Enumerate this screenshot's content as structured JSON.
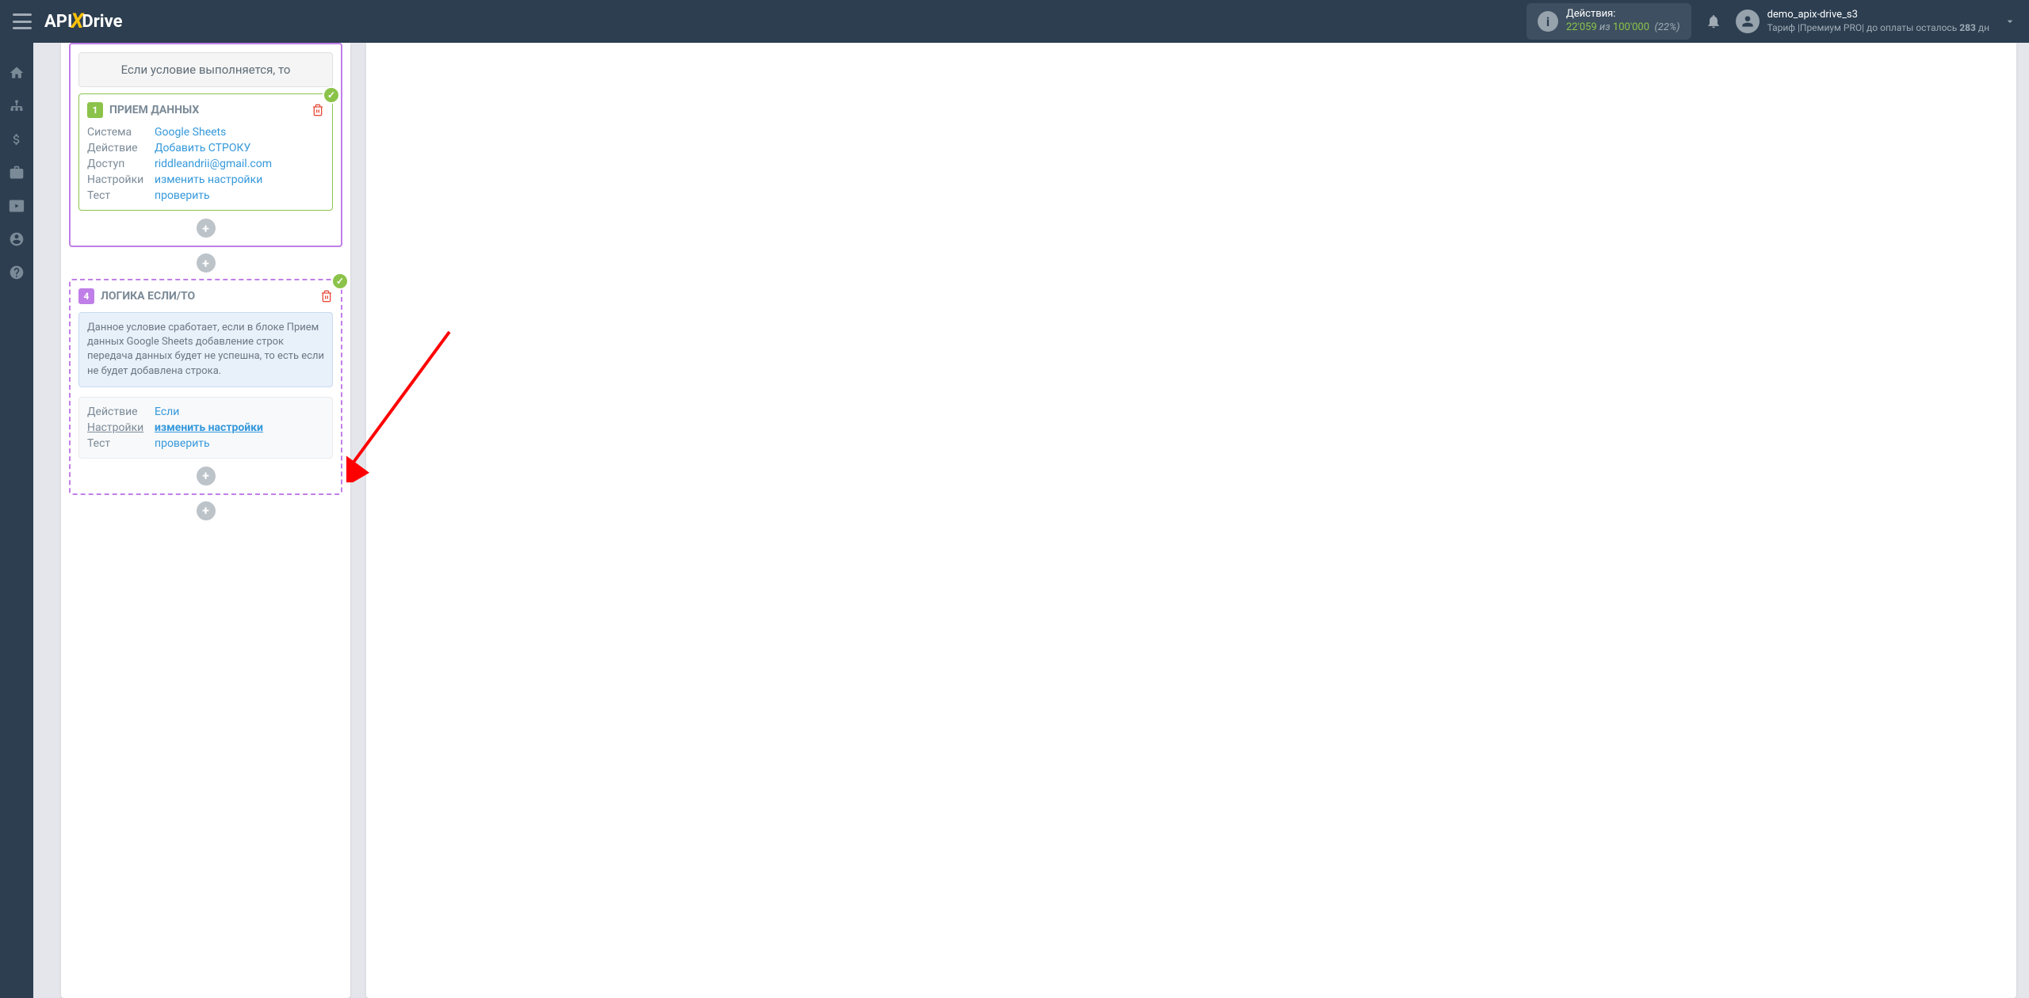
{
  "header": {
    "logo_api": "API",
    "logo_drive": "Drive",
    "actions_label": "Действия:",
    "actions_current": "22'059",
    "actions_of": " из ",
    "actions_total": "100'000",
    "actions_percent": "(22%)",
    "username": "demo_apix-drive_s3",
    "tariff_prefix": "Тариф |Премиум PRO| до оплаты осталось ",
    "tariff_days": "283",
    "tariff_suffix": " дн"
  },
  "condition_bar": "Если условие выполняется, то",
  "block1": {
    "num": "1",
    "title": "ПРИЕМ ДАННЫХ",
    "fields": {
      "system_label": "Система",
      "system_value": "Google Sheets",
      "action_label": "Действие",
      "action_value": "Добавить СТРОКУ",
      "access_label": "Доступ",
      "access_value": "riddleandrii@gmail.com",
      "settings_label": "Настройки",
      "settings_value": "изменить настройки",
      "test_label": "Тест",
      "test_value": "проверить"
    }
  },
  "block4": {
    "num": "4",
    "title": "ЛОГИКА ЕСЛИ/ТО",
    "info": "Данное условие сработает, если в блоке Прием данных Google Sheets добавление строк передача данных будет не успешна, то есть если не будет добавлена строка.",
    "fields": {
      "action_label": "Действие",
      "action_value": "Если",
      "settings_label": "Настройки",
      "settings_value": "изменить настройки",
      "test_label": "Тест",
      "test_value": "проверить"
    }
  }
}
